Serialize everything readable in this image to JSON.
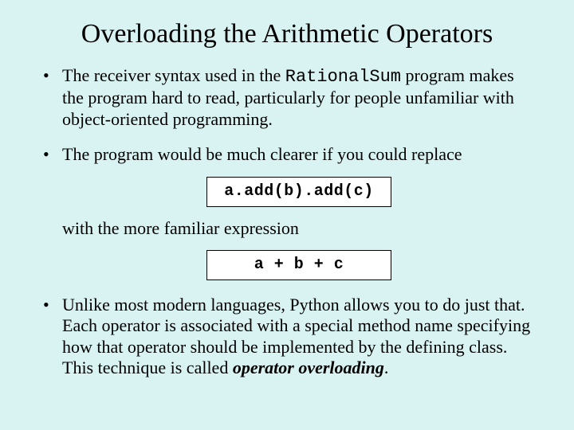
{
  "title": "Overloading the Arithmetic Operators",
  "bullets": {
    "b1a": "The receiver syntax used in the ",
    "b1code": "RationalSum",
    "b1b": " program makes the program hard to read, particularly for people unfamiliar with object-oriented programming.",
    "b2": "The program would be much clearer if you could replace",
    "code1": "a.add(b).add(c)",
    "b2sub": "with the more familiar expression",
    "code2": "a + b + c",
    "b3a": "Unlike most modern languages, Python allows you to do just that.  Each operator is associated with a special method name specifying how that operator should be implemented by the defining class.  This technique is called ",
    "b3em": "operator overloading",
    "b3b": "."
  }
}
